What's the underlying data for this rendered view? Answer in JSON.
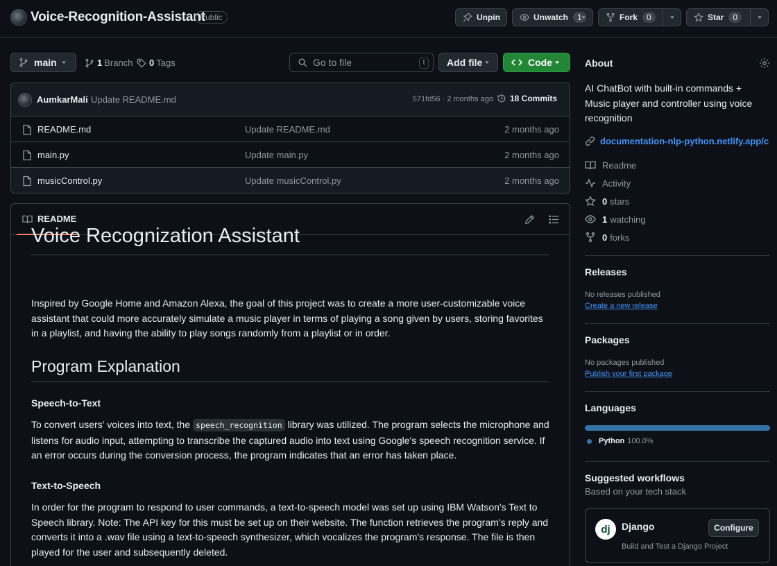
{
  "repo": {
    "name": "Voice-Recognition-Assistant",
    "visibility": "Public"
  },
  "header_actions": {
    "unpin": "Unpin",
    "unwatch": "Unwatch",
    "watch_count": "1",
    "fork": "Fork",
    "fork_count": "0",
    "star": "Star",
    "star_count": "0"
  },
  "toolbar": {
    "branch": "main",
    "branch_count": "1",
    "branch_label": "Branch",
    "tag_count": "0",
    "tag_label": "Tags",
    "search_placeholder": "Go to file",
    "search_shortcut": "t",
    "add_file": "Add file",
    "code": "Code"
  },
  "latest_commit": {
    "author": "AumkarMali",
    "message": "Update README.md",
    "hash_age": "571fd56 · 2 months ago",
    "commits": "18 Commits"
  },
  "files": [
    {
      "name": "README.md",
      "message": "Update README.md",
      "age": "2 months ago"
    },
    {
      "name": "main.py",
      "message": "Update main.py",
      "age": "2 months ago"
    },
    {
      "name": "musicControl.py",
      "message": "Update musicControl.py",
      "age": "2 months ago"
    }
  ],
  "readme": {
    "tab": "README",
    "h1": "Voice Recognization Assistant",
    "intro": "Inspired by Google Home and Amazon Alexa, the goal of this project was to create a more user-customizable voice assistant that could more accurately simulate a music player in terms of playing a song given by users, storing favorites in a playlist, and having the ability to play songs randomly from a playlist or in order.",
    "h2": "Program Explanation",
    "s1_title": "Speech-to-Text",
    "s1_before": "To convert users' voices into text, the ",
    "s1_code": "speech_recognition",
    "s1_after": " library was utilized. The program selects the microphone and listens for audio input, attempting to transcribe the captured audio into text using Google's speech recognition service. If an error occurs during the conversion process, the program indicates that an error has taken place.",
    "s2_title": "Text-to-Speech",
    "s2_text": "In order for the program to respond to user commands, a text-to-speech model was set up using IBM Watson's Text to Speech library. Note: The API key for this must be set up on their website. The function retrieves the program's reply and converts it into a .wav file using a text-to-speech synthesizer, which vocalizes the program's response. The file is then played for the user and subsequently deleted."
  },
  "about": {
    "title": "About",
    "description": "AI ChatBot with built-in commands + Music player and controller using voice recognition",
    "link": "documentation-nlp-python.netlify.app/c...",
    "readme": "Readme",
    "activity": "Activity",
    "stars_count": "0",
    "stars_label": "stars",
    "watching_count": "1",
    "watching_label": "watching",
    "forks_count": "0",
    "forks_label": "forks"
  },
  "releases": {
    "title": "Releases",
    "empty": "No releases published",
    "create": "Create a new release"
  },
  "packages": {
    "title": "Packages",
    "empty": "No packages published",
    "publish": "Publish your first package"
  },
  "languages": {
    "title": "Languages",
    "items": [
      {
        "name": "Python",
        "percent": "100.0%",
        "share": 100,
        "color": "#3572A5"
      }
    ]
  },
  "workflows": {
    "title": "Suggested workflows",
    "subtitle": "Based on your tech stack",
    "card_logo": "dj",
    "card_name": "Django",
    "card_desc": "Build and Test a Django Project",
    "configure": "Configure"
  },
  "colors": {
    "background": "#0d1117",
    "border": "#3d444d",
    "link": "#4493f8",
    "primary_button": "#238636",
    "tab_underline": "#f78166"
  }
}
